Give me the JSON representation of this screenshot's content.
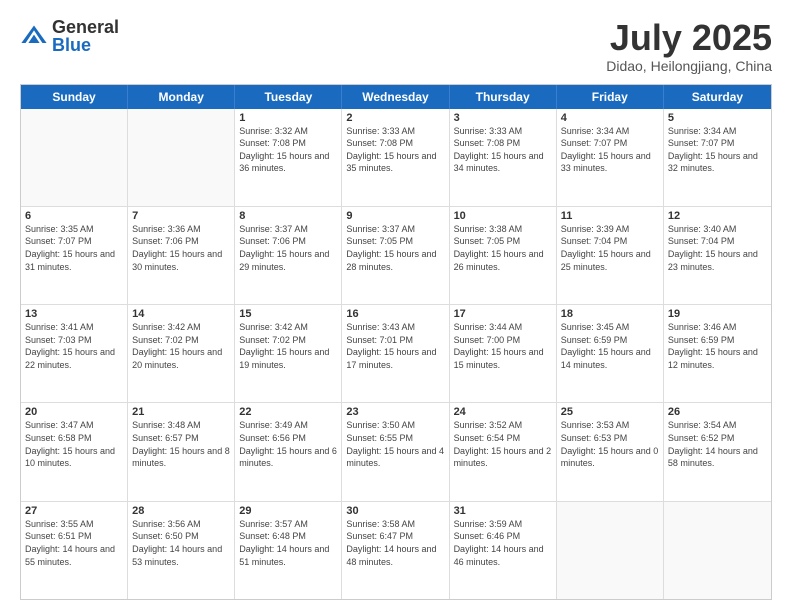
{
  "logo": {
    "general": "General",
    "blue": "Blue"
  },
  "title": {
    "month": "July 2025",
    "location": "Didao, Heilongjiang, China"
  },
  "header_days": [
    "Sunday",
    "Monday",
    "Tuesday",
    "Wednesday",
    "Thursday",
    "Friday",
    "Saturday"
  ],
  "weeks": [
    [
      {
        "day": "",
        "info": ""
      },
      {
        "day": "",
        "info": ""
      },
      {
        "day": "1",
        "info": "Sunrise: 3:32 AM\nSunset: 7:08 PM\nDaylight: 15 hours and 36 minutes."
      },
      {
        "day": "2",
        "info": "Sunrise: 3:33 AM\nSunset: 7:08 PM\nDaylight: 15 hours and 35 minutes."
      },
      {
        "day": "3",
        "info": "Sunrise: 3:33 AM\nSunset: 7:08 PM\nDaylight: 15 hours and 34 minutes."
      },
      {
        "day": "4",
        "info": "Sunrise: 3:34 AM\nSunset: 7:07 PM\nDaylight: 15 hours and 33 minutes."
      },
      {
        "day": "5",
        "info": "Sunrise: 3:34 AM\nSunset: 7:07 PM\nDaylight: 15 hours and 32 minutes."
      }
    ],
    [
      {
        "day": "6",
        "info": "Sunrise: 3:35 AM\nSunset: 7:07 PM\nDaylight: 15 hours and 31 minutes."
      },
      {
        "day": "7",
        "info": "Sunrise: 3:36 AM\nSunset: 7:06 PM\nDaylight: 15 hours and 30 minutes."
      },
      {
        "day": "8",
        "info": "Sunrise: 3:37 AM\nSunset: 7:06 PM\nDaylight: 15 hours and 29 minutes."
      },
      {
        "day": "9",
        "info": "Sunrise: 3:37 AM\nSunset: 7:05 PM\nDaylight: 15 hours and 28 minutes."
      },
      {
        "day": "10",
        "info": "Sunrise: 3:38 AM\nSunset: 7:05 PM\nDaylight: 15 hours and 26 minutes."
      },
      {
        "day": "11",
        "info": "Sunrise: 3:39 AM\nSunset: 7:04 PM\nDaylight: 15 hours and 25 minutes."
      },
      {
        "day": "12",
        "info": "Sunrise: 3:40 AM\nSunset: 7:04 PM\nDaylight: 15 hours and 23 minutes."
      }
    ],
    [
      {
        "day": "13",
        "info": "Sunrise: 3:41 AM\nSunset: 7:03 PM\nDaylight: 15 hours and 22 minutes."
      },
      {
        "day": "14",
        "info": "Sunrise: 3:42 AM\nSunset: 7:02 PM\nDaylight: 15 hours and 20 minutes."
      },
      {
        "day": "15",
        "info": "Sunrise: 3:42 AM\nSunset: 7:02 PM\nDaylight: 15 hours and 19 minutes."
      },
      {
        "day": "16",
        "info": "Sunrise: 3:43 AM\nSunset: 7:01 PM\nDaylight: 15 hours and 17 minutes."
      },
      {
        "day": "17",
        "info": "Sunrise: 3:44 AM\nSunset: 7:00 PM\nDaylight: 15 hours and 15 minutes."
      },
      {
        "day": "18",
        "info": "Sunrise: 3:45 AM\nSunset: 6:59 PM\nDaylight: 15 hours and 14 minutes."
      },
      {
        "day": "19",
        "info": "Sunrise: 3:46 AM\nSunset: 6:59 PM\nDaylight: 15 hours and 12 minutes."
      }
    ],
    [
      {
        "day": "20",
        "info": "Sunrise: 3:47 AM\nSunset: 6:58 PM\nDaylight: 15 hours and 10 minutes."
      },
      {
        "day": "21",
        "info": "Sunrise: 3:48 AM\nSunset: 6:57 PM\nDaylight: 15 hours and 8 minutes."
      },
      {
        "day": "22",
        "info": "Sunrise: 3:49 AM\nSunset: 6:56 PM\nDaylight: 15 hours and 6 minutes."
      },
      {
        "day": "23",
        "info": "Sunrise: 3:50 AM\nSunset: 6:55 PM\nDaylight: 15 hours and 4 minutes."
      },
      {
        "day": "24",
        "info": "Sunrise: 3:52 AM\nSunset: 6:54 PM\nDaylight: 15 hours and 2 minutes."
      },
      {
        "day": "25",
        "info": "Sunrise: 3:53 AM\nSunset: 6:53 PM\nDaylight: 15 hours and 0 minutes."
      },
      {
        "day": "26",
        "info": "Sunrise: 3:54 AM\nSunset: 6:52 PM\nDaylight: 14 hours and 58 minutes."
      }
    ],
    [
      {
        "day": "27",
        "info": "Sunrise: 3:55 AM\nSunset: 6:51 PM\nDaylight: 14 hours and 55 minutes."
      },
      {
        "day": "28",
        "info": "Sunrise: 3:56 AM\nSunset: 6:50 PM\nDaylight: 14 hours and 53 minutes."
      },
      {
        "day": "29",
        "info": "Sunrise: 3:57 AM\nSunset: 6:48 PM\nDaylight: 14 hours and 51 minutes."
      },
      {
        "day": "30",
        "info": "Sunrise: 3:58 AM\nSunset: 6:47 PM\nDaylight: 14 hours and 48 minutes."
      },
      {
        "day": "31",
        "info": "Sunrise: 3:59 AM\nSunset: 6:46 PM\nDaylight: 14 hours and 46 minutes."
      },
      {
        "day": "",
        "info": ""
      },
      {
        "day": "",
        "info": ""
      }
    ]
  ]
}
